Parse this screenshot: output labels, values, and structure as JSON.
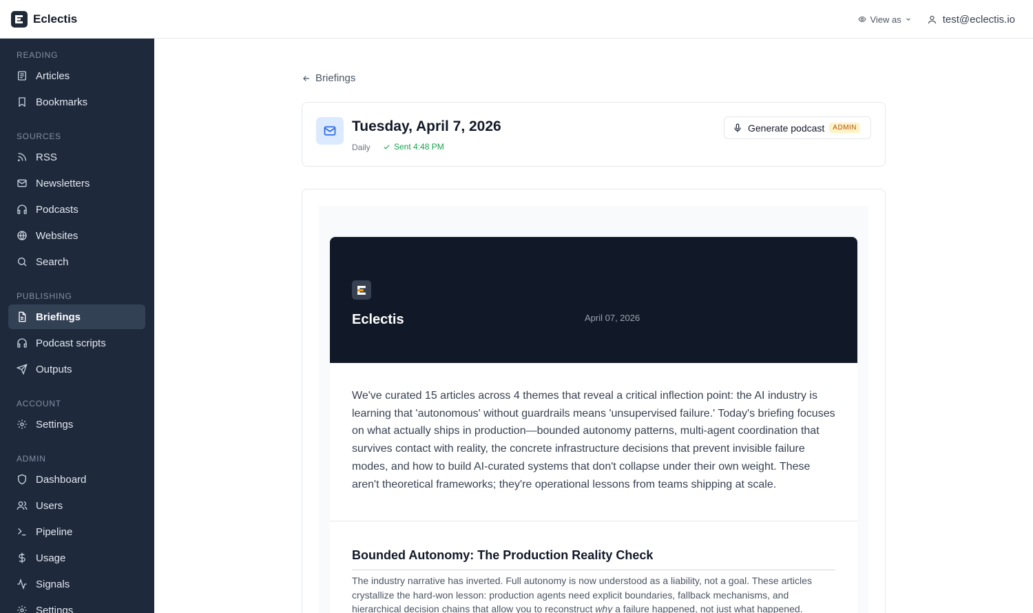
{
  "app": {
    "name": "Eclectis"
  },
  "topbar": {
    "view_as_label": "View as",
    "user_email": "test@eclectis.io"
  },
  "sidebar": {
    "sections": [
      {
        "title": "READING",
        "items": [
          {
            "label": "Articles",
            "icon": "articles-icon"
          },
          {
            "label": "Bookmarks",
            "icon": "bookmark-icon"
          }
        ]
      },
      {
        "title": "SOURCES",
        "items": [
          {
            "label": "RSS",
            "icon": "rss-icon"
          },
          {
            "label": "Newsletters",
            "icon": "mail-icon"
          },
          {
            "label": "Podcasts",
            "icon": "headphones-icon"
          },
          {
            "label": "Websites",
            "icon": "globe-icon"
          },
          {
            "label": "Search",
            "icon": "search-icon"
          }
        ]
      },
      {
        "title": "PUBLISHING",
        "items": [
          {
            "label": "Briefings",
            "icon": "document-icon",
            "active": true
          },
          {
            "label": "Podcast scripts",
            "icon": "headphones-icon"
          },
          {
            "label": "Outputs",
            "icon": "send-icon"
          }
        ]
      },
      {
        "title": "ACCOUNT",
        "items": [
          {
            "label": "Settings",
            "icon": "gear-icon"
          }
        ]
      },
      {
        "title": "ADMIN",
        "items": [
          {
            "label": "Dashboard",
            "icon": "shield-icon"
          },
          {
            "label": "Users",
            "icon": "users-icon"
          },
          {
            "label": "Pipeline",
            "icon": "terminal-icon"
          },
          {
            "label": "Usage",
            "icon": "dollar-icon"
          },
          {
            "label": "Signals",
            "icon": "activity-icon"
          },
          {
            "label": "Settings",
            "icon": "gear-icon"
          }
        ]
      }
    ]
  },
  "breadcrumb": {
    "back_label": "Briefings"
  },
  "briefing": {
    "title": "Tuesday, April 7, 2026",
    "frequency": "Daily",
    "status": "Sent 4:48 PM",
    "status_color": "#16a34a",
    "podcast_button": "Generate podcast",
    "admin_badge": "ADMIN"
  },
  "email": {
    "brand": "Eclectis",
    "date": "April 07, 2026",
    "intro": "We've curated 15 articles across 4 themes that reveal a critical inflection point: the AI industry is learning that 'autonomous' without guardrails means 'unsupervised failure.' Today's briefing focuses on what actually ships in production—bounded autonomy patterns, multi-agent coordination that survives contact with reality, the concrete infrastructure decisions that prevent invisible failure modes, and how to build AI-curated systems that don't collapse under their own weight. These aren't theoretical frameworks; they're operational lessons from teams shipping at scale.",
    "theme_title": "Bounded Autonomy: The Production Reality Check",
    "theme_text_before": "The industry narrative has inverted. Full autonomy is now understood as a liability, not a goal. These articles crystallize the hard-won lesson: production agents need explicit boundaries, fallback mechanisms, and hierarchical decision chains that allow you to reconstruct ",
    "theme_text_em": "why",
    "theme_text_after": " a failure happened, not just what happened."
  },
  "colors": {
    "sidebar_bg": "#1e293b",
    "active_bg": "#334155",
    "hero_bg": "#111827",
    "accent": "#2563eb"
  }
}
